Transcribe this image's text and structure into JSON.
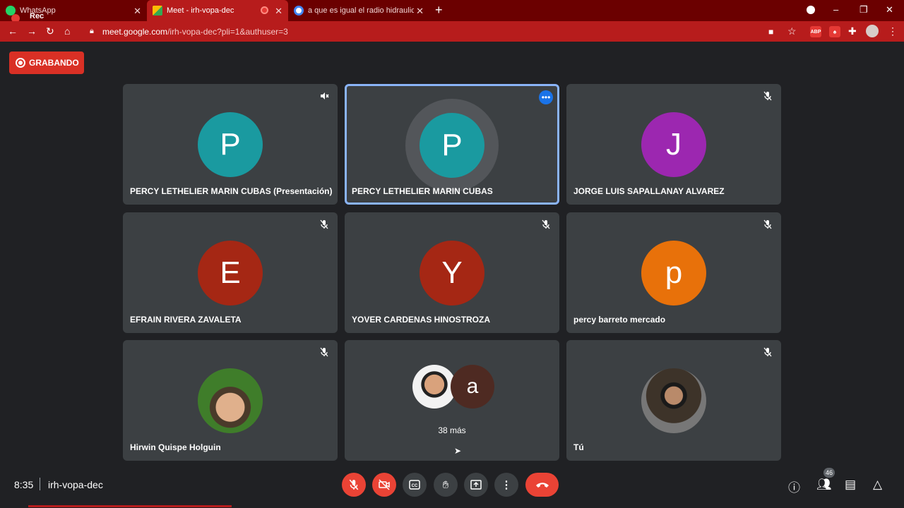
{
  "browser": {
    "tabs": [
      {
        "title": "WhatsApp",
        "overlay": "Rec"
      },
      {
        "title": "Meet - irh-vopa-dec"
      },
      {
        "title": "a que es igual el radio hidraulico"
      }
    ],
    "url_host": "meet.google.com",
    "url_path": "/irh-vopa-dec?pli=1&authuser=3",
    "extensions": [
      "ABP"
    ],
    "new_tab": "+"
  },
  "meet": {
    "recording_label": "GRABANDO",
    "tiles": [
      {
        "name": "PERCY LETHELIER MARIN CUBAS (Presentación)",
        "initial": "P",
        "color": "#1a9aa0"
      },
      {
        "name": "PERCY LETHELIER MARIN CUBAS",
        "initial": "P",
        "color": "#1a9aa0"
      },
      {
        "name": "JORGE LUIS SAPALLANAY ALVAREZ",
        "initial": "J",
        "color": "#9c27b0"
      },
      {
        "name": "EFRAIN RIVERA ZAVALETA",
        "initial": "E",
        "color": "#a52714"
      },
      {
        "name": "YOVER CARDENAS HINOSTROZA",
        "initial": "Y",
        "color": "#a52714"
      },
      {
        "name": "percy barreto mercado",
        "initial": "p",
        "color": "#e8710a"
      },
      {
        "name": "Hirwin Quispe Holguin"
      },
      {
        "more": "38 más",
        "initial": "a",
        "color": "#4e2a22"
      },
      {
        "name": "Tú"
      }
    ]
  },
  "bottom": {
    "time": "8:35",
    "meeting_code": "irh-vopa-dec",
    "participants_count": "46"
  },
  "icons": [
    "whatsapp-icon",
    "meet-icon",
    "google-icon",
    "back-icon",
    "forward-icon",
    "reload-icon",
    "home-icon",
    "lock-icon",
    "camera-icon",
    "star-icon",
    "puzzle-icon",
    "profile-icon",
    "menu-icon",
    "mic-off-icon",
    "more-dots-icon",
    "mic-icon",
    "cam-off-icon",
    "captions-icon",
    "hand-icon",
    "present-icon",
    "hangup-icon",
    "info-icon",
    "people-icon",
    "chat-icon",
    "activities-icon"
  ]
}
